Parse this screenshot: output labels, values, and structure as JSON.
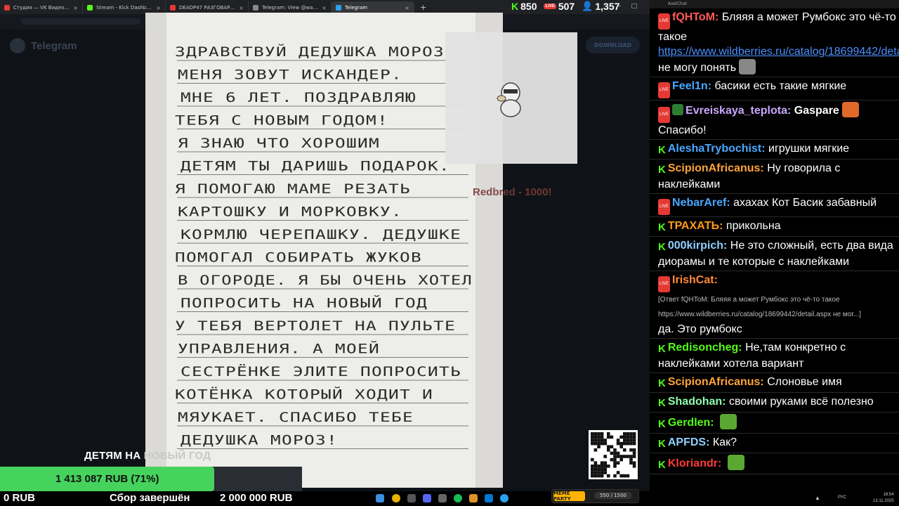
{
  "tabs": [
    {
      "label": "Студия — VK Видео Live",
      "color": "#e53935"
    },
    {
      "label": "Stream - Kick Dashboard",
      "color": "#53fc18"
    },
    {
      "label": "DEADP47 РАЗГОВАРИВАЕТ С ...",
      "color": "#e53935"
    },
    {
      "label": "Telegram: View @warwebm",
      "color": "#888888"
    },
    {
      "label": "Telegram",
      "color": "#2aa3ef"
    }
  ],
  "stats": {
    "kick": "850",
    "vk_live": "507",
    "viewers": "1,357",
    "live_badge": "LIVE"
  },
  "telegram": {
    "app_name": "Telegram",
    "download_label": "DOWNLOAD"
  },
  "letter_lines": [
    "ЗДРАВСТВУЙ ДЕДУШКА МОРОЗ",
    "МЕНЯ ЗОВУТ ИСКАНДЕР.",
    "МНЕ 6 ЛЕТ. ПОЗДРАВЛЯЮ",
    "ТЕБЯ С НОВЫМ ГОДОМ!",
    "Я ЗНАЮ ЧТО ХОРОШИМ",
    "ДЕТЯМ ТЫ ДАРИШЬ ПОДАРОК.",
    "Я ПОМОГАЮ МАМЕ РЕЗАТЬ",
    "КАРТОШКУ И МОРКОВКУ.",
    "КОРМЛЮ ЧЕРЕПАШКУ. ДЕДУШКЕ",
    "ПОМОГАЛ СОБИРАТЬ ЖУКОВ",
    "В ОГОРОДЕ. Я БЫ ОЧЕНЬ ХОТЕЛ",
    "ПОПРОСИТЬ НА НОВЫЙ ГОД",
    "У ТЕБЯ ВЕРТОЛЕТ НА ПУЛЬТЕ",
    "УПРАВЛЕНИЯ. А МОЕЙ",
    "СЕСТРЁНКЕ ЭЛИТЕ ПОПРОСИТЬ",
    "КОТЁНКА КОТОРЫЙ ХОДИТ И",
    "МЯУКАЕТ. СПАСИБО ТЕБЕ",
    "ДЕДУШКА МОРОЗ!"
  ],
  "alert": "Redbred - 1000!",
  "donation": {
    "title_main": "ДЕТЯМ НА ",
    "title_hl": "НОВЫЙ ГОД",
    "amount": "1 413 087 RUB (71%)",
    "progress": 0.71,
    "left": "0 RUB",
    "status": "Сбор завершён",
    "goal": "2 000 000 RUB"
  },
  "meme_party": {
    "logo": "MEME PARTY",
    "value": "550 / 1500"
  },
  "tray": {
    "lang": "РУС",
    "time": "18:54",
    "date": "13.11.2025"
  },
  "chat": {
    "header": "AxelChat",
    "messages": [
      {
        "badge": "live",
        "user": "fQHToM:",
        "color": "#ff5a5a",
        "text": "Бляяя а может Румбокс это чё-то такое",
        "link": "https://www.wildberries.ru/catalog/18699442/detail.aspx",
        "after": "не могу понять",
        "emote": "#888888"
      },
      {
        "badge": "live",
        "user": "Feel1n:",
        "color": "#4aa8ff",
        "text": "басики есть такие мягкие"
      },
      {
        "badge": "live_pen",
        "user": "Evreiskaya_teplota:",
        "color": "#c9a7ff",
        "text": "Gaspare",
        "emote": "#e06a2a",
        "after": "Спасибо!"
      },
      {
        "badge": "kick",
        "user": "AleshaTrybochist:",
        "color": "#4aa8ff",
        "text": "игрушки мягкие"
      },
      {
        "badge": "kick",
        "user": "ScipionAfricanus:",
        "color": "#ffa43a",
        "text": "Ну говорила с наклейками"
      },
      {
        "badge": "live",
        "user": "NebarAref:",
        "color": "#4aa8ff",
        "text": "ахахах Кот Басик забавный"
      },
      {
        "badge": "kick",
        "user": "ТРАХАТЬ:",
        "color": "#ff9a1a",
        "text": "прикольна"
      },
      {
        "badge": "kick",
        "user": "000kirpich:",
        "color": "#8fd0ff",
        "text": "Не это сложный, есть два вида диорамы и те которые с наклейками"
      },
      {
        "badge": "live",
        "user": "IrishCat:",
        "color": "#ff8a3a",
        "reply": "[Ответ fQHToM: Бляяя а может Румбокс это чё-то такое https://www.wildberries.ru/catalog/18699442/detail.aspx не мог...]",
        "text": "да. Это румбокс"
      },
      {
        "badge": "kick",
        "user": "Redisoncheg:",
        "color": "#53fc18",
        "text": "Не,там конкретно с наклейками хотела вариант"
      },
      {
        "badge": "kick",
        "user": "ScipionAfricanus:",
        "color": "#ffa43a",
        "text": "Слоновье имя"
      },
      {
        "badge": "kick",
        "user": "Shadohan:",
        "color": "#8fffb0",
        "text": "своими руками всё полезно"
      },
      {
        "badge": "kick",
        "user": "Gerdlen:",
        "color": "#53fc18",
        "text": "",
        "emote": "#5aa832"
      },
      {
        "badge": "kick",
        "user": "APFDS:",
        "color": "#8fd0ff",
        "text": "Как?"
      },
      {
        "badge": "kick",
        "user": "Kloriandr:",
        "color": "#ff3a3a",
        "text": "",
        "emote": "#5aa832"
      }
    ]
  }
}
